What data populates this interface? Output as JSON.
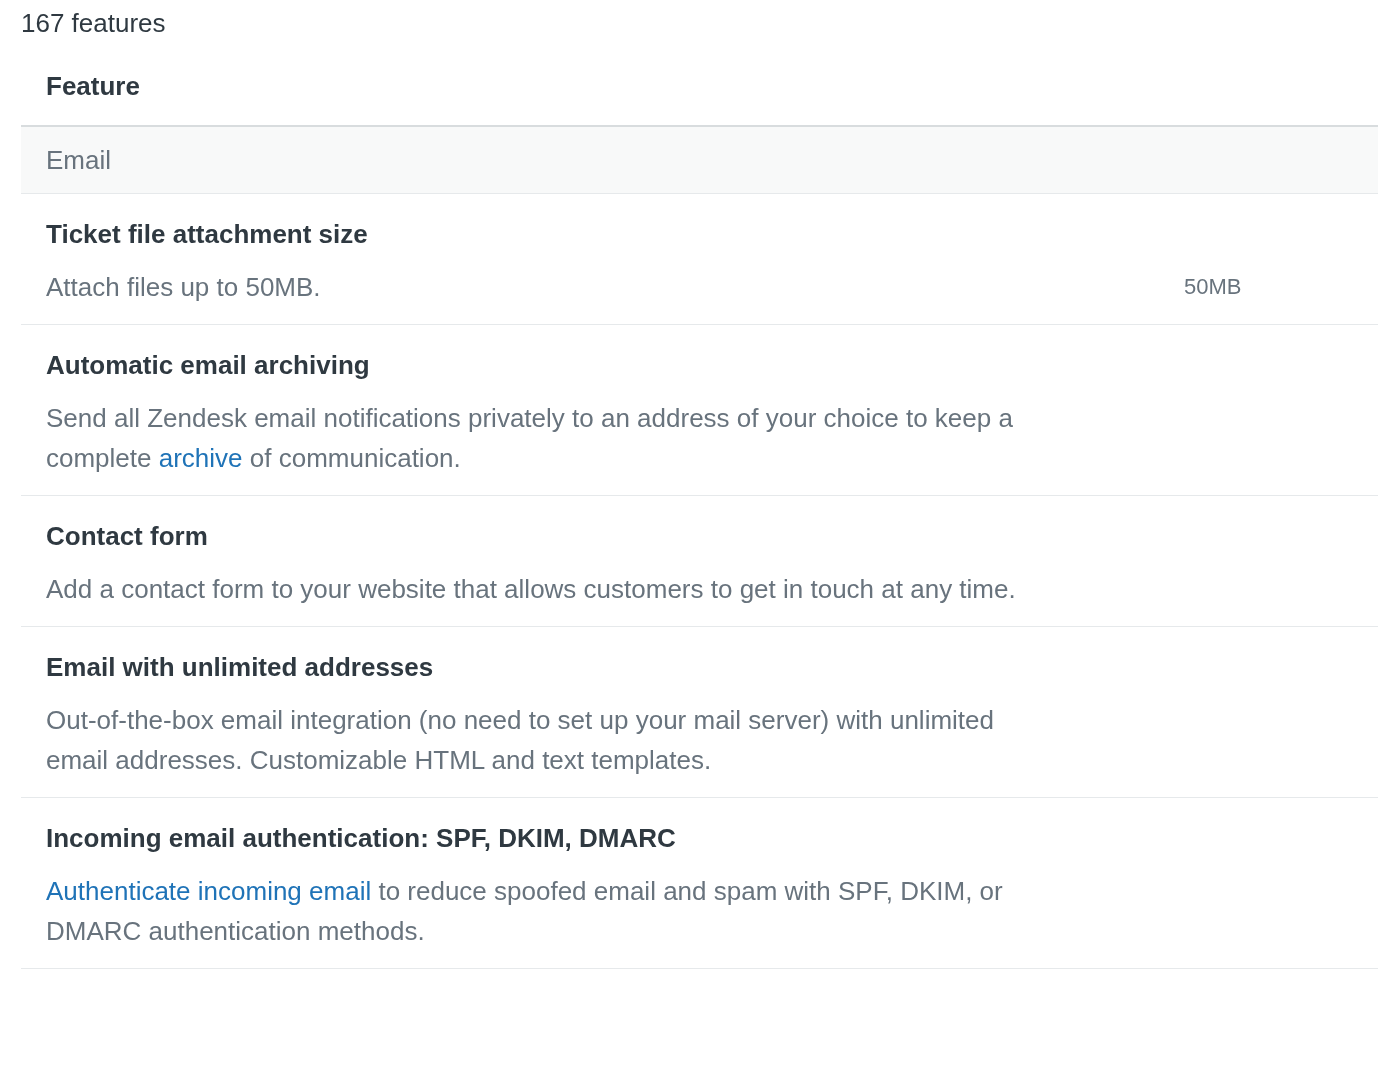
{
  "count": "167 features",
  "table": {
    "columns": [
      "Feature"
    ],
    "category": "Email",
    "rows": [
      {
        "title": "Ticket file attachment size",
        "description": [
          {
            "text": "Attach files up to 50MB.",
            "link": false
          }
        ],
        "value": "50MB"
      },
      {
        "title": "Automatic email archiving",
        "description": [
          {
            "text": "Send all Zendesk email notifications privately to an address of your choice to keep a complete ",
            "link": false
          },
          {
            "text": "archive",
            "link": true
          },
          {
            "text": " of communication.",
            "link": false
          }
        ]
      },
      {
        "title": "Contact form",
        "description": [
          {
            "text": "Add a contact form to your website that allows customers to get in touch at any time.",
            "link": false
          }
        ]
      },
      {
        "title": "Email with unlimited addresses",
        "description": [
          {
            "text": "Out-of-the-box email integration (no need to set up your mail server) with unlimited email addresses. Customizable HTML and text templates.",
            "link": false
          }
        ]
      },
      {
        "title": "Incoming email authentication: SPF, DKIM, DMARC",
        "description": [
          {
            "text": "Authenticate incoming email",
            "link": true
          },
          {
            "text": " to reduce spoofed email and spam with SPF, DKIM, or DMARC authentication methods.",
            "link": false
          }
        ]
      }
    ]
  }
}
